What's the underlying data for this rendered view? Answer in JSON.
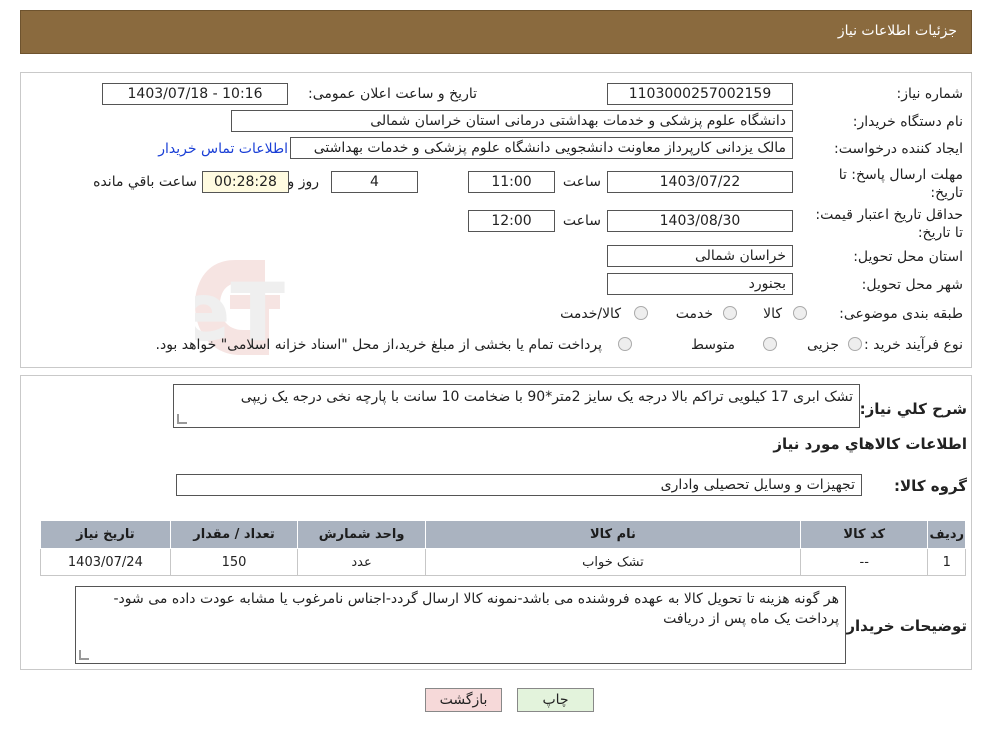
{
  "header": {
    "title": "جزئیات اطلاعات نیاز"
  },
  "form": {
    "need_number_label": "شماره نیاز:",
    "need_number": "1103000257002159",
    "announce_label": "تاریخ و ساعت اعلان عمومی:",
    "announce_value": "1403/07/18 - 10:16",
    "buyer_org_label": "نام دستگاه خریدار:",
    "buyer_org": "دانشگاه علوم پزشکی و خدمات بهداشتی درمانی استان خراسان شمالی",
    "requester_label": "ایجاد کننده درخواست:",
    "requester": "مالک یزدانی کارپرداز معاونت دانشجویی دانشگاه علوم پزشکی و خدمات بهداشتی",
    "contact_link": "اطلاعات تماس خریدار",
    "deadline_label": "مهلت ارسال پاسخ: تا تاریخ:",
    "deadline_date": "1403/07/22",
    "time_label": "ساعت",
    "deadline_time": "11:00",
    "days_value": "4",
    "days_label": "روز و",
    "remaining_time": "00:28:28",
    "remaining_label": "ساعت باقي مانده",
    "validity_label": "حداقل تاریخ اعتبار قیمت: تا تاریخ:",
    "validity_date": "1403/08/30",
    "validity_time": "12:00",
    "province_label": "استان محل تحویل:",
    "province": "خراسان شمالی",
    "city_label": "شهر محل تحویل:",
    "city": "بجنورد",
    "category_label": "طبقه بندی موضوعی:",
    "category_options": [
      "کالا",
      "خدمت",
      "کالا/خدمت"
    ],
    "process_label": "نوع فرآیند خرید :",
    "process_options": [
      "جزیی",
      "متوسط"
    ],
    "process_note": "پرداخت تمام یا بخشی از مبلغ خرید،از محل \"اسناد خزانه اسلامی\" خواهد بود."
  },
  "watermark": {
    "text": "AriaTender.neT"
  },
  "details": {
    "summary_label": "شرح کلي نياز:",
    "summary": "تشک ابری 17 کیلویی تراکم بالا درجه یک سایز 2متر*90 با ضخامت 10 سانت با پارچه نخی درجه یک زیپی",
    "goods_info_title": "اطلاعات کالاهاي مورد نياز",
    "goods_group_label": "گروه کالا:",
    "goods_group": "تجهیزات و وسایل تحصیلی واداری",
    "table": {
      "headers": [
        "رديف",
        "کد کالا",
        "نام کالا",
        "واحد شمارش",
        "تعداد / مقدار",
        "تاريخ نياز"
      ],
      "rows": [
        [
          "1",
          "--",
          "تشک خواب",
          "عدد",
          "150",
          "1403/07/24"
        ]
      ]
    },
    "buyer_notes_label": "توضیحات خریدار:",
    "buyer_notes": "هر گونه هزینه تا تحویل کالا به عهده فروشنده می باشد-نمونه کالا ارسال گردد-اجناس نامرغوب یا مشابه عودت داده می شود-پرداخت یک ماه پس از دریافت"
  },
  "buttons": {
    "print": "چاپ",
    "back": "بازگشت"
  },
  "colors": {
    "header_bg": "#8a6a3e",
    "table_header": "#aab3c0",
    "link": "#1a3fd6",
    "back_button": "#f6d9d9",
    "print_button": "#e3f3dc"
  }
}
